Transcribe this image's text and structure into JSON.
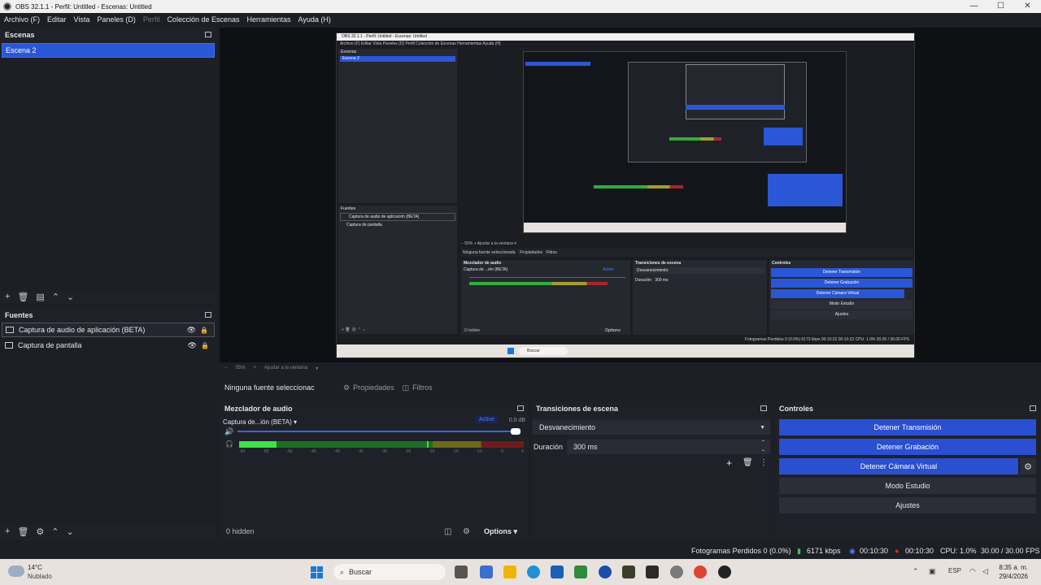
{
  "window": {
    "title": "OBS 32.1.1 - Perfil: Untitled - Escenas: Untitled",
    "min": "—",
    "max": "☐",
    "close": "✕"
  },
  "menu": [
    "Archivo (F)",
    "Editar",
    "Vista",
    "Paneles (D)",
    "Perfil",
    "Colección de Escenas",
    "Herramientas",
    "Ayuda (H)"
  ],
  "scenes": {
    "title": "Escenas",
    "items": [
      "Escena 2"
    ]
  },
  "sources": {
    "title": "Fuentes",
    "items": [
      "Captura de audio de aplicación (BETA)",
      "Captura de pantalla"
    ]
  },
  "preview": {
    "zoom": "55%",
    "fit": "Ajustar a la ventana",
    "nested_title": "OBS 32.1.1 - Perfil: Untitled - Escenas: Untitled",
    "nested_menu": "Archivo (F)   Editar   Vista   Paneles (D)   Perfil   Colección de Escenas   Herramientas   Ayuda (H)",
    "nested_scenes": "Escenas",
    "nested_scene_item": "Escena 2",
    "nested_sources": "Fuentes",
    "nested_source_1": "Captura de audio de aplicación (BETA)",
    "nested_source_2": "Captura de pantalla",
    "nested_nosel": "Ninguna fuente seleccionada",
    "nested_props": "Propiedades",
    "nested_filters": "Filtros",
    "nested_mixer": "Mezclador de audio",
    "nested_mixer_source": "Captura de ...ión (BETA)",
    "nested_active": "Active",
    "nested_transitions": "Transiciones de escena",
    "nested_fade": "Desvanecimiento",
    "nested_duration": "Duración",
    "nested_duration_value": "300 ms",
    "nested_controls": "Controles",
    "nested_btns": [
      "Detener Transmisión",
      "Detener Grabación",
      "Detener Cámara Virtual",
      "Modo Estudio",
      "Ajustes"
    ],
    "nested_hidden": "0 hidden",
    "nested_options": "Options",
    "nested_status": "Fotogramas Perdidos 0 (0.0%)   6173 kbps   00:10:22   00:10:22   CPU: 1.0%   30.00 / 30.00 FPS"
  },
  "props": {
    "no_selection": "Ninguna fuente seleccionac",
    "properties": "Propiedades",
    "filters": "Filtros"
  },
  "mixer": {
    "title": "Mezclador de audio",
    "source": "Captura de...ión (BETA)",
    "active": "Active",
    "db": "0.0 dB",
    "meter_level": 0.13,
    "peak_level": 0.66,
    "scale": [
      "-60",
      "-55",
      "-50",
      "-45",
      "-40",
      "-35",
      "-30",
      "-25",
      "-20",
      "-15",
      "-10",
      "-5",
      "0"
    ],
    "hidden": "0 hidden",
    "options": "Options"
  },
  "transitions": {
    "title": "Transiciones de escena",
    "type": "Desvanecimiento",
    "duration_label": "Duración",
    "duration_value": "300 ms"
  },
  "controls": {
    "title": "Controles",
    "buttons": [
      "Detener Transmisión",
      "Detener Grabación",
      "Detener Cámara Virtual",
      "Modo Estudio",
      "Ajustes"
    ]
  },
  "status": {
    "dropped": "Fotogramas Perdidos 0 (0.0%)",
    "kbps": "6171 kbps",
    "stream_time": "00:10:30",
    "rec_time": "00:10:30",
    "cpu": "CPU: 1.0%",
    "fps": "30.00 / 30.00 FPS"
  },
  "taskbar": {
    "temp": "14°C",
    "weather": "Nublado",
    "search": "Buscar",
    "lang": "ESP",
    "time": "8:35 a. m.",
    "date": "29/4/2026"
  },
  "colors": {
    "accent": "#2a4fd0",
    "selection": "#2a57d6",
    "meter_green": "#3fe048",
    "rec_red": "#e02828",
    "stream_green": "#3fbf48"
  }
}
